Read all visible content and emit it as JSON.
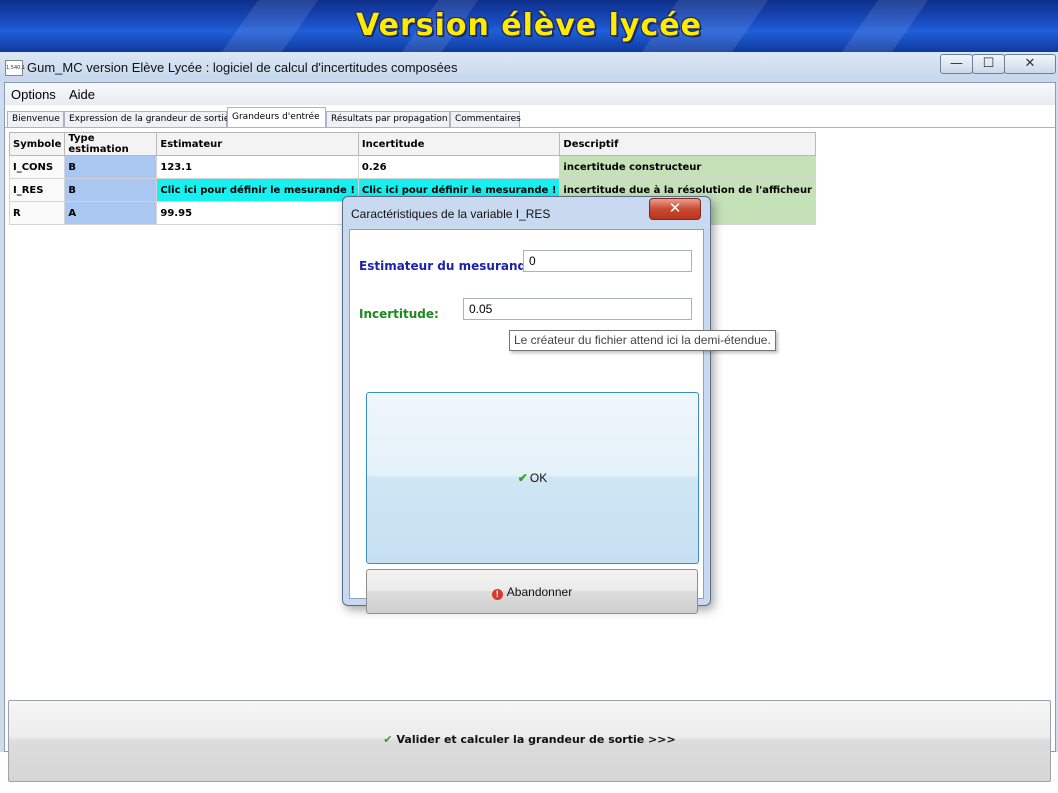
{
  "banner": {
    "title": "Version élève lycée"
  },
  "window": {
    "title": "Gum_MC version Elève Lycée : logiciel de calcul d'incertitudes composées",
    "icon_text": "1,540,1",
    "controls": {
      "minimize": "—",
      "maximize": "☐",
      "close": "✕"
    }
  },
  "menu": {
    "items": [
      "Options",
      "Aide"
    ]
  },
  "tabs": [
    {
      "label": "Bienvenue"
    },
    {
      "label": "Expression de la grandeur de sortie"
    },
    {
      "label": "Grandeurs d'entrée",
      "active": true
    },
    {
      "label": "Résultats par propagation"
    },
    {
      "label": "Commentaires"
    }
  ],
  "table": {
    "headers": [
      "Symbole",
      "Type estimation",
      "Estimateur",
      "Incertitude",
      "Descriptif"
    ],
    "rows": [
      [
        "I_CONS",
        "B",
        "123.1",
        "0.26",
        "incertitude constructeur"
      ],
      [
        "I_RES",
        "B",
        "Clic ici pour définir le mesurande !",
        "Clic ici pour définir le mesurande !",
        "incertitude due à la résolution de l'afficheur"
      ],
      [
        "R",
        "A",
        "99.95",
        "",
        ""
      ]
    ]
  },
  "dialog": {
    "title": "Caractéristiques de la variable I_RES",
    "close": "✕",
    "estimateur_label": "Estimateur du mesurande:",
    "estimateur_value": "0",
    "incertitude_label": "Incertitude:",
    "incertitude_value": "0.05",
    "tooltip": "Le créateur du fichier attend ici la demi-étendue.",
    "ok_label": "OK",
    "cancel_label": "Abandonner"
  },
  "footer": {
    "validate_label": "Valider et calculer la grandeur de sortie >>>"
  },
  "colors": {
    "banner_text": "#ffeb00",
    "type_cell": "#a9c7f0",
    "cyan_cell": "#17f0f0",
    "desc_cell": "#c4e1b8",
    "label_blue": "#1a22b0",
    "label_green": "#1a8a1a",
    "check_green": "#36a02c",
    "stop_red": "#d23b2b"
  },
  "icons": {
    "check": "check-icon",
    "stop": "stop-icon"
  }
}
